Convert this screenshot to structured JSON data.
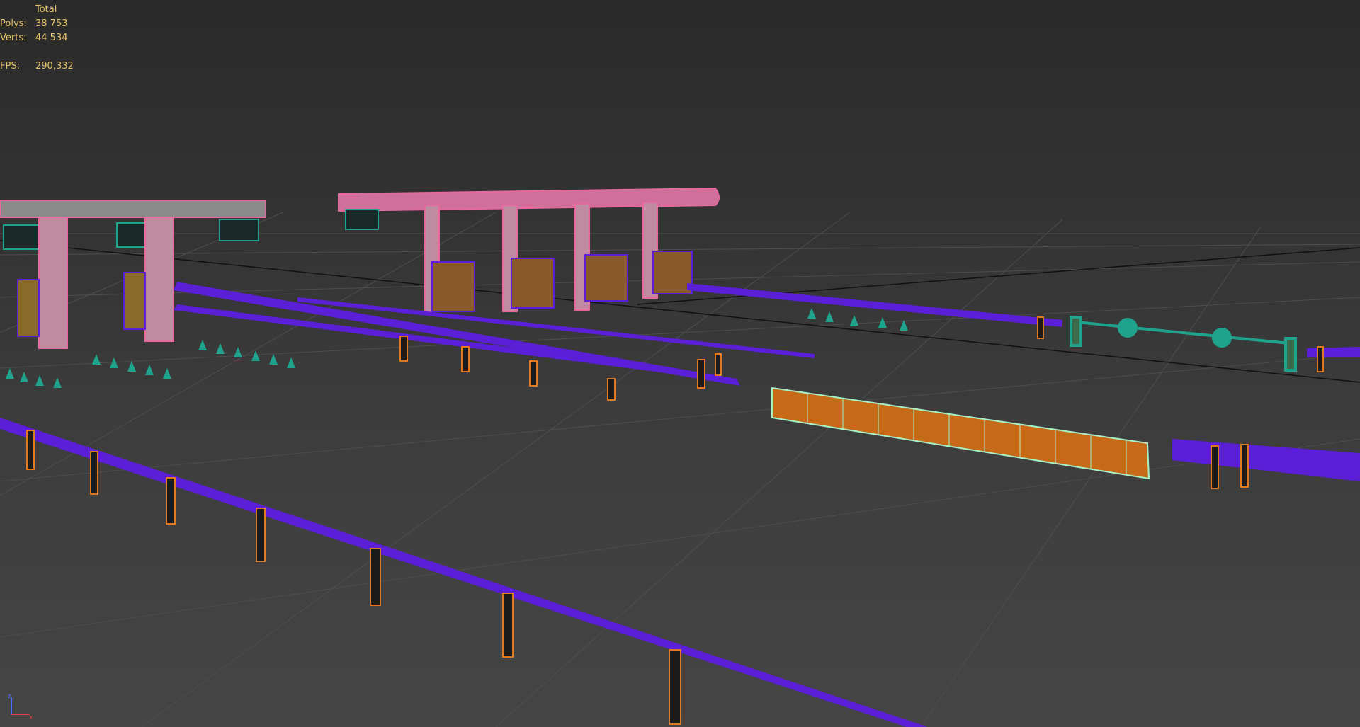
{
  "stats": {
    "header": "Total",
    "polys_label": "Polys:",
    "polys_value": "38 753",
    "verts_label": "Verts:",
    "verts_value": "44 534",
    "fps_label": "FPS:",
    "fps_value": "290,332"
  },
  "axis_gizmo": {
    "z_label": "z",
    "x_label": "x"
  },
  "colors": {
    "guardrail": "#5a1fd6",
    "post": "#e07a20",
    "canopy": "#e46aa0",
    "booth": "#1fa38c",
    "barrier": "#c66a18",
    "grid": "#555555"
  }
}
